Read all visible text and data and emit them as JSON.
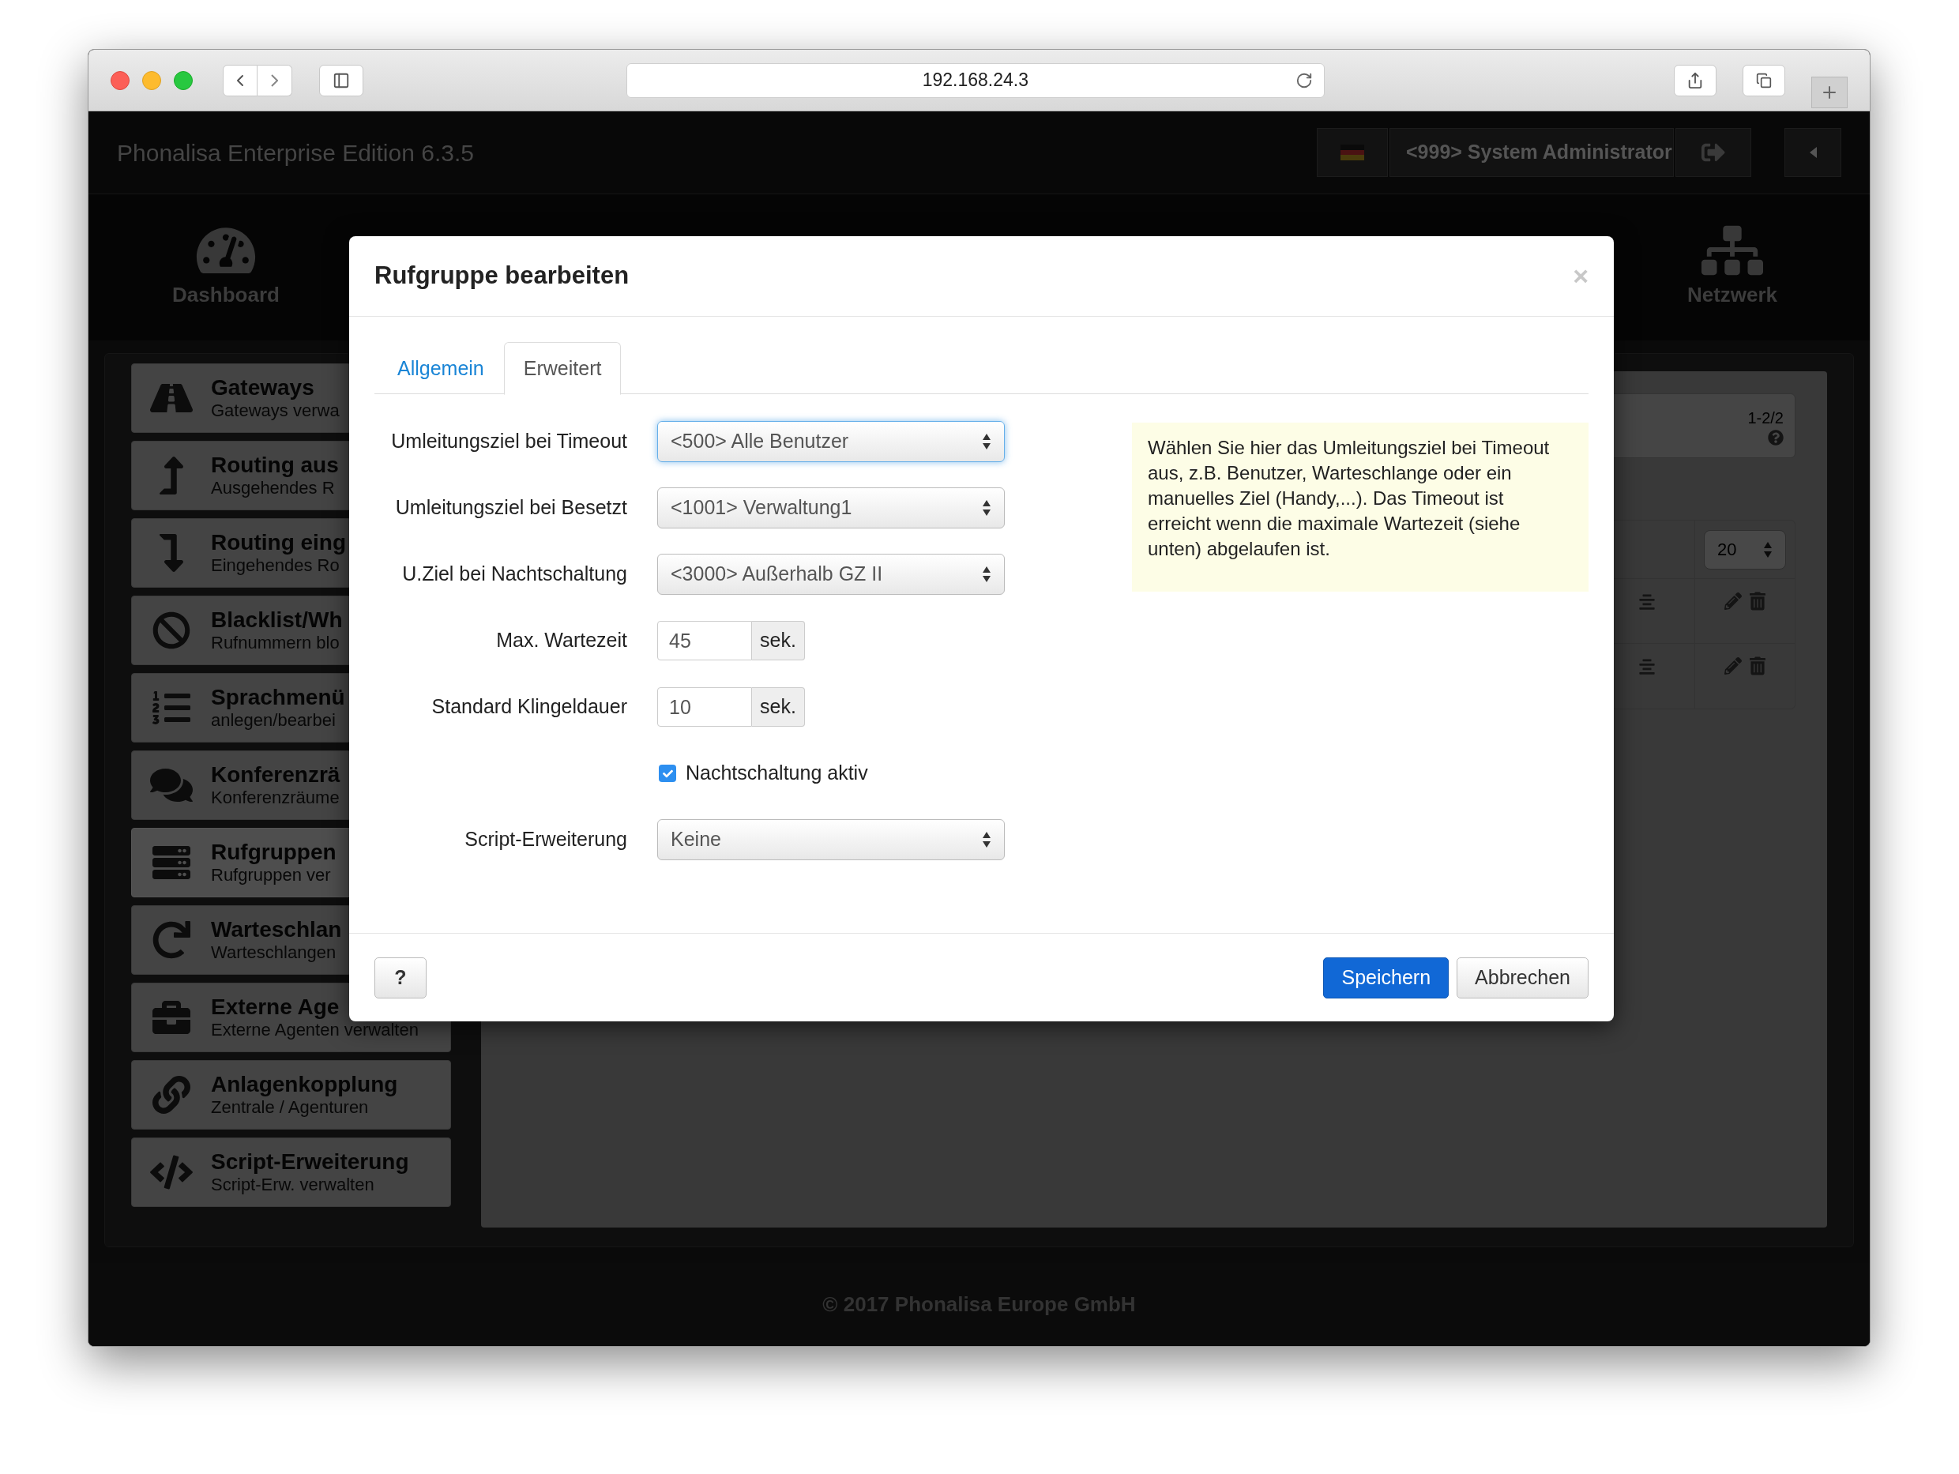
{
  "browser": {
    "url": "192.168.24.3"
  },
  "app": {
    "title": "Phonalisa Enterprise Edition 6.3.5",
    "user": "<999> System Administrator"
  },
  "nav": [
    {
      "label": "Dashboard"
    },
    {
      "label": "Netzwerk"
    }
  ],
  "sidebar": {
    "items": [
      {
        "title": "Gateways",
        "subtitle": "Gateways verwa",
        "selected": false
      },
      {
        "title": "Routing aus",
        "subtitle": "Ausgehendes R",
        "selected": false
      },
      {
        "title": "Routing eing",
        "subtitle": "Eingehendes Ro",
        "selected": false
      },
      {
        "title": "Blacklist/Wh",
        "subtitle": "Rufnummern blo",
        "selected": false
      },
      {
        "title": "Sprachmenü",
        "subtitle": "anlegen/bearbei",
        "selected": false
      },
      {
        "title": "Konferenzrä",
        "subtitle": "Konferenzräume",
        "selected": false
      },
      {
        "title": "Rufgruppen",
        "subtitle": "Rufgruppen ver",
        "selected": true
      },
      {
        "title": "Warteschlan",
        "subtitle": "Warteschlangen",
        "selected": false
      },
      {
        "title": "Externe Age",
        "subtitle": "Externe Agenten verwalten",
        "selected": false
      },
      {
        "title": "Anlagenkopplung",
        "subtitle": "Zentrale / Agenturen",
        "selected": false
      },
      {
        "title": "Script-Erweiterung",
        "subtitle": "Script-Erw. verwalten",
        "selected": false
      }
    ]
  },
  "list_panel": {
    "range": "1-2/2",
    "page_size": "20",
    "rows": [
      {
        "kind": "row"
      },
      {
        "kind": "row"
      }
    ]
  },
  "dialog": {
    "title": "Rufgruppe bearbeiten",
    "close": "×",
    "tabs": [
      {
        "label": "Allgemein",
        "selected": false
      },
      {
        "label": "Erweitert",
        "selected": true
      }
    ],
    "fields": [
      {
        "kind": "select",
        "label": "Umleitungsziel bei Timeout",
        "value": "<500> Alle Benutzer",
        "focused": true
      },
      {
        "kind": "select",
        "label": "Umleitungsziel bei Besetzt",
        "value": "<1001> Verwaltung1",
        "focused": false
      },
      {
        "kind": "select",
        "label": "U.Ziel bei Nachtschaltung",
        "value": "<3000> Außerhalb GZ II",
        "focused": false
      },
      {
        "kind": "number",
        "label": "Max. Wartezeit",
        "value": "45",
        "unit": "sek."
      },
      {
        "kind": "number",
        "label": "Standard Klingeldauer",
        "value": "10",
        "unit": "sek."
      },
      {
        "kind": "checkbox",
        "label": "Nachtschaltung aktiv",
        "checked": true
      },
      {
        "kind": "select",
        "label": "Script-Erweiterung",
        "value": "Keine",
        "focused": false
      }
    ],
    "help": "Wählen Sie hier das Umleitungsziel bei Timeout aus, z.B. Benutzer, Warteschlange oder ein manuelles Ziel (Handy,...). Das Timeout ist erreicht wenn die maximale Wartezeit (siehe unten) abgelaufen ist.",
    "buttons": [
      {
        "label": "?",
        "kind": "default"
      },
      {
        "label": "Speichern",
        "kind": "primary"
      },
      {
        "label": "Abbrechen",
        "kind": "default"
      }
    ]
  },
  "footer": "© 2017 Phonalisa Europe GmbH"
}
